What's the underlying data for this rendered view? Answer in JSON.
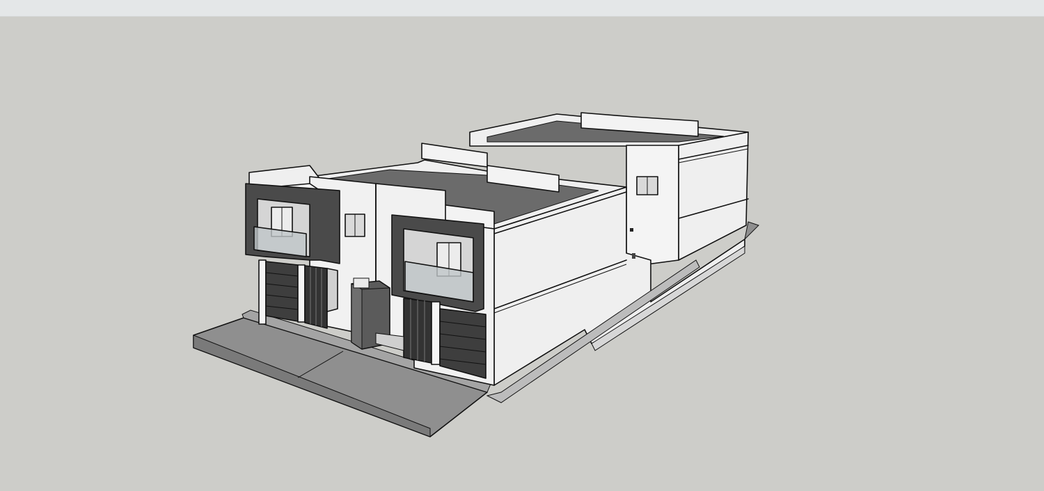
{
  "window": {
    "title": ""
  },
  "viewport": {
    "background": "#cdcdc9",
    "model": "two-storey-townhouses",
    "colors": {
      "wall": "#f1f1f1",
      "wall_shade": "#dcdcdc",
      "roof": "#6b6b6b",
      "cladding": "#4a4a4a",
      "pavement": "#8f8f8f",
      "glass": "#bfc6c8"
    }
  }
}
